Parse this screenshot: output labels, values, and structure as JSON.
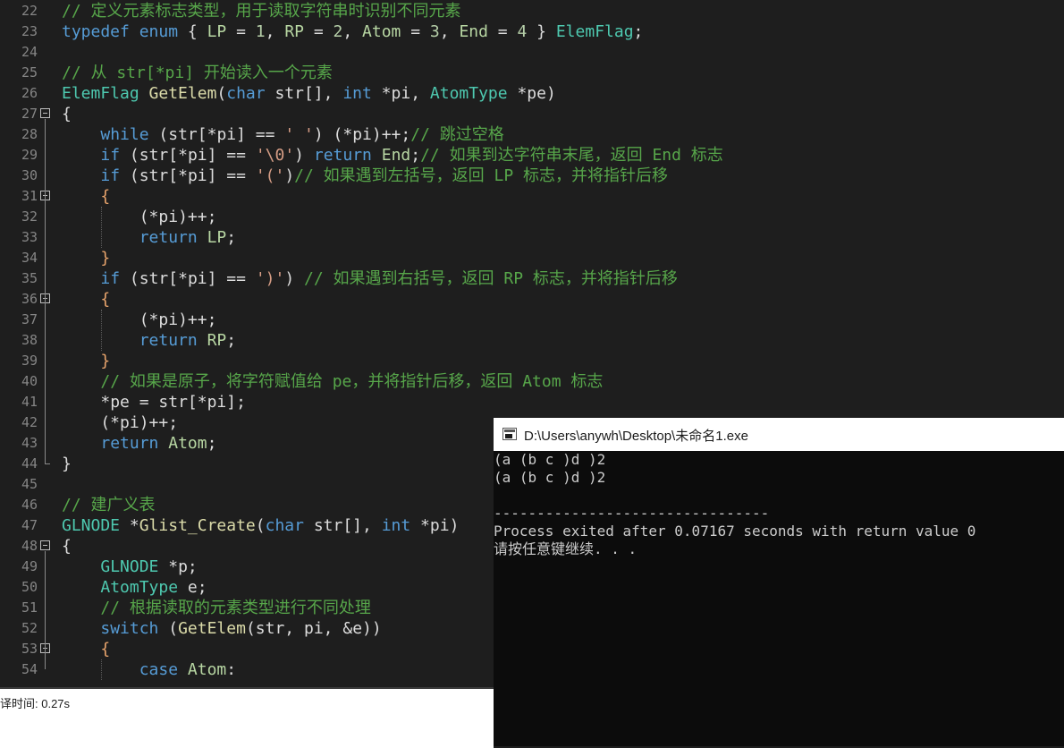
{
  "editor": {
    "lines": [
      {
        "n": "22",
        "t": [
          [
            "cm",
            "// 定义元素标志类型，用于读取字符串时识别不同元素"
          ]
        ]
      },
      {
        "n": "23",
        "t": [
          [
            "kw",
            "typedef"
          ],
          [
            "pu",
            " "
          ],
          [
            "kw",
            "enum"
          ],
          [
            "pu",
            " { "
          ],
          [
            "en",
            "LP"
          ],
          [
            "pu",
            " = "
          ],
          [
            "num",
            "1"
          ],
          [
            "pu",
            ", "
          ],
          [
            "en",
            "RP"
          ],
          [
            "pu",
            " = "
          ],
          [
            "num",
            "2"
          ],
          [
            "pu",
            ", "
          ],
          [
            "en",
            "Atom"
          ],
          [
            "pu",
            " = "
          ],
          [
            "num",
            "3"
          ],
          [
            "pu",
            ", "
          ],
          [
            "en",
            "End"
          ],
          [
            "pu",
            " = "
          ],
          [
            "num",
            "4"
          ],
          [
            "pu",
            " } "
          ],
          [
            "ty",
            "ElemFlag"
          ],
          [
            "pu",
            ";"
          ]
        ]
      },
      {
        "n": "24",
        "t": []
      },
      {
        "n": "25",
        "t": [
          [
            "cm",
            "// 从 str[*pi] 开始读入一个元素"
          ]
        ]
      },
      {
        "n": "26",
        "t": [
          [
            "ty",
            "ElemFlag"
          ],
          [
            "pu",
            " "
          ],
          [
            "fn",
            "GetElem"
          ],
          [
            "pu",
            "("
          ],
          [
            "kw",
            "char"
          ],
          [
            "pu",
            " "
          ],
          [
            "id",
            "str"
          ],
          [
            "pu",
            "[], "
          ],
          [
            "kw",
            "int"
          ],
          [
            "pu",
            " *"
          ],
          [
            "id",
            "pi"
          ],
          [
            "pu",
            ", "
          ],
          [
            "ty",
            "AtomType"
          ],
          [
            "pu",
            " *"
          ],
          [
            "id",
            "pe"
          ],
          [
            "pu",
            ")"
          ]
        ]
      },
      {
        "n": "27",
        "t": [
          [
            "pu",
            "{"
          ]
        ]
      },
      {
        "n": "28",
        "t": [
          [
            "pu",
            "    "
          ],
          [
            "kw",
            "while"
          ],
          [
            "pu",
            " ("
          ],
          [
            "id",
            "str"
          ],
          [
            "pu",
            "[*"
          ],
          [
            "id",
            "pi"
          ],
          [
            "pu",
            "] == "
          ],
          [
            "str",
            "' '"
          ],
          [
            "pu",
            ") (*"
          ],
          [
            "id",
            "pi"
          ],
          [
            "pu",
            ")++;"
          ],
          [
            "cm",
            "// 跳过空格"
          ]
        ]
      },
      {
        "n": "29",
        "t": [
          [
            "pu",
            "    "
          ],
          [
            "kw",
            "if"
          ],
          [
            "pu",
            " ("
          ],
          [
            "id",
            "str"
          ],
          [
            "pu",
            "[*"
          ],
          [
            "id",
            "pi"
          ],
          [
            "pu",
            "] == "
          ],
          [
            "str",
            "'\\0'"
          ],
          [
            "pu",
            ") "
          ],
          [
            "kw",
            "return"
          ],
          [
            "pu",
            " "
          ],
          [
            "en",
            "End"
          ],
          [
            "pu",
            ";"
          ],
          [
            "cm",
            "// 如果到达字符串末尾，返回 End 标志"
          ]
        ]
      },
      {
        "n": "30",
        "t": [
          [
            "pu",
            "    "
          ],
          [
            "kw",
            "if"
          ],
          [
            "pu",
            " ("
          ],
          [
            "id",
            "str"
          ],
          [
            "pu",
            "[*"
          ],
          [
            "id",
            "pi"
          ],
          [
            "pu",
            "] == "
          ],
          [
            "str",
            "'('"
          ],
          [
            "pu",
            ")"
          ],
          [
            "cm",
            "// 如果遇到左括号，返回 LP 标志，并将指针后移"
          ]
        ]
      },
      {
        "n": "31",
        "t": [
          [
            "pu",
            "    "
          ],
          [
            "br",
            "{"
          ]
        ]
      },
      {
        "n": "32",
        "t": [
          [
            "pu",
            "        (*"
          ],
          [
            "id",
            "pi"
          ],
          [
            "pu",
            ")++;"
          ]
        ]
      },
      {
        "n": "33",
        "t": [
          [
            "pu",
            "        "
          ],
          [
            "kw",
            "return"
          ],
          [
            "pu",
            " "
          ],
          [
            "en",
            "LP"
          ],
          [
            "pu",
            ";"
          ]
        ]
      },
      {
        "n": "34",
        "t": [
          [
            "pu",
            "    "
          ],
          [
            "br",
            "}"
          ]
        ]
      },
      {
        "n": "35",
        "t": [
          [
            "pu",
            "    "
          ],
          [
            "kw",
            "if"
          ],
          [
            "pu",
            " ("
          ],
          [
            "id",
            "str"
          ],
          [
            "pu",
            "[*"
          ],
          [
            "id",
            "pi"
          ],
          [
            "pu",
            "] == "
          ],
          [
            "str",
            "')'"
          ],
          [
            "pu",
            ") "
          ],
          [
            "cm",
            "// 如果遇到右括号，返回 RP 标志，并将指针后移"
          ]
        ]
      },
      {
        "n": "36",
        "t": [
          [
            "pu",
            "    "
          ],
          [
            "br",
            "{"
          ]
        ]
      },
      {
        "n": "37",
        "t": [
          [
            "pu",
            "        (*"
          ],
          [
            "id",
            "pi"
          ],
          [
            "pu",
            ")++;"
          ]
        ]
      },
      {
        "n": "38",
        "t": [
          [
            "pu",
            "        "
          ],
          [
            "kw",
            "return"
          ],
          [
            "pu",
            " "
          ],
          [
            "en",
            "RP"
          ],
          [
            "pu",
            ";"
          ]
        ]
      },
      {
        "n": "39",
        "t": [
          [
            "pu",
            "    "
          ],
          [
            "br",
            "}"
          ]
        ]
      },
      {
        "n": "40",
        "t": [
          [
            "pu",
            "    "
          ],
          [
            "cm",
            "// 如果是原子，将字符赋值给 pe，并将指针后移，返回 Atom 标志"
          ]
        ]
      },
      {
        "n": "41",
        "t": [
          [
            "pu",
            "    *"
          ],
          [
            "id",
            "pe"
          ],
          [
            "pu",
            " = "
          ],
          [
            "id",
            "str"
          ],
          [
            "pu",
            "[*"
          ],
          [
            "id",
            "pi"
          ],
          [
            "pu",
            "];"
          ]
        ]
      },
      {
        "n": "42",
        "t": [
          [
            "pu",
            "    (*"
          ],
          [
            "id",
            "pi"
          ],
          [
            "pu",
            ")++;"
          ]
        ]
      },
      {
        "n": "43",
        "t": [
          [
            "pu",
            "    "
          ],
          [
            "kw",
            "return"
          ],
          [
            "pu",
            " "
          ],
          [
            "en",
            "Atom"
          ],
          [
            "pu",
            ";"
          ]
        ]
      },
      {
        "n": "44",
        "t": [
          [
            "pu",
            "}"
          ]
        ]
      },
      {
        "n": "45",
        "t": []
      },
      {
        "n": "46",
        "t": [
          [
            "cm",
            "// 建广义表"
          ]
        ]
      },
      {
        "n": "47",
        "t": [
          [
            "ty",
            "GLNODE"
          ],
          [
            "pu",
            " *"
          ],
          [
            "fn",
            "Glist_Create"
          ],
          [
            "pu",
            "("
          ],
          [
            "kw",
            "char"
          ],
          [
            "pu",
            " "
          ],
          [
            "id",
            "str"
          ],
          [
            "pu",
            "[], "
          ],
          [
            "kw",
            "int"
          ],
          [
            "pu",
            " *"
          ],
          [
            "id",
            "pi"
          ],
          [
            "pu",
            ")"
          ]
        ]
      },
      {
        "n": "48",
        "t": [
          [
            "pu",
            "{"
          ]
        ]
      },
      {
        "n": "49",
        "t": [
          [
            "pu",
            "    "
          ],
          [
            "ty",
            "GLNODE"
          ],
          [
            "pu",
            " *"
          ],
          [
            "id",
            "p"
          ],
          [
            "pu",
            ";"
          ]
        ]
      },
      {
        "n": "50",
        "t": [
          [
            "pu",
            "    "
          ],
          [
            "ty",
            "AtomType"
          ],
          [
            "pu",
            " "
          ],
          [
            "id",
            "e"
          ],
          [
            "pu",
            ";"
          ]
        ]
      },
      {
        "n": "51",
        "t": [
          [
            "pu",
            "    "
          ],
          [
            "cm",
            "// 根据读取的元素类型进行不同处理"
          ]
        ]
      },
      {
        "n": "52",
        "t": [
          [
            "pu",
            "    "
          ],
          [
            "kw",
            "switch"
          ],
          [
            "pu",
            " ("
          ],
          [
            "fn",
            "GetElem"
          ],
          [
            "pu",
            "("
          ],
          [
            "id",
            "str"
          ],
          [
            "pu",
            ", "
          ],
          [
            "id",
            "pi"
          ],
          [
            "pu",
            ", &"
          ],
          [
            "id",
            "e"
          ],
          [
            "pu",
            "))"
          ]
        ]
      },
      {
        "n": "53",
        "t": [
          [
            "pu",
            "    "
          ],
          [
            "br",
            "{"
          ]
        ]
      },
      {
        "n": "54",
        "t": [
          [
            "pu",
            "        "
          ],
          [
            "kw",
            "case"
          ],
          [
            "pu",
            " "
          ],
          [
            "en",
            "Atom"
          ],
          [
            "pu",
            ":"
          ]
        ]
      }
    ]
  },
  "bottom_panel": {
    "status_text": "译时间: 0.27s"
  },
  "console": {
    "title": "D:\\Users\\anywh\\Desktop\\未命名1.exe",
    "icon": "console-window-icon",
    "lines": [
      "(a (b c )d )2",
      "(a (b c )d )2",
      "",
      "--------------------------------",
      "Process exited after 0.07167 seconds with return value 0",
      "请按任意键继续. . ."
    ]
  },
  "colors": {
    "editor_bg": "#1e1e1e",
    "keyword": "#569cd6",
    "type": "#4ec9b0",
    "comment": "#57a64a",
    "enum": "#b8d7a3",
    "string": "#d69d85",
    "console_bg": "#0c0c0c"
  }
}
